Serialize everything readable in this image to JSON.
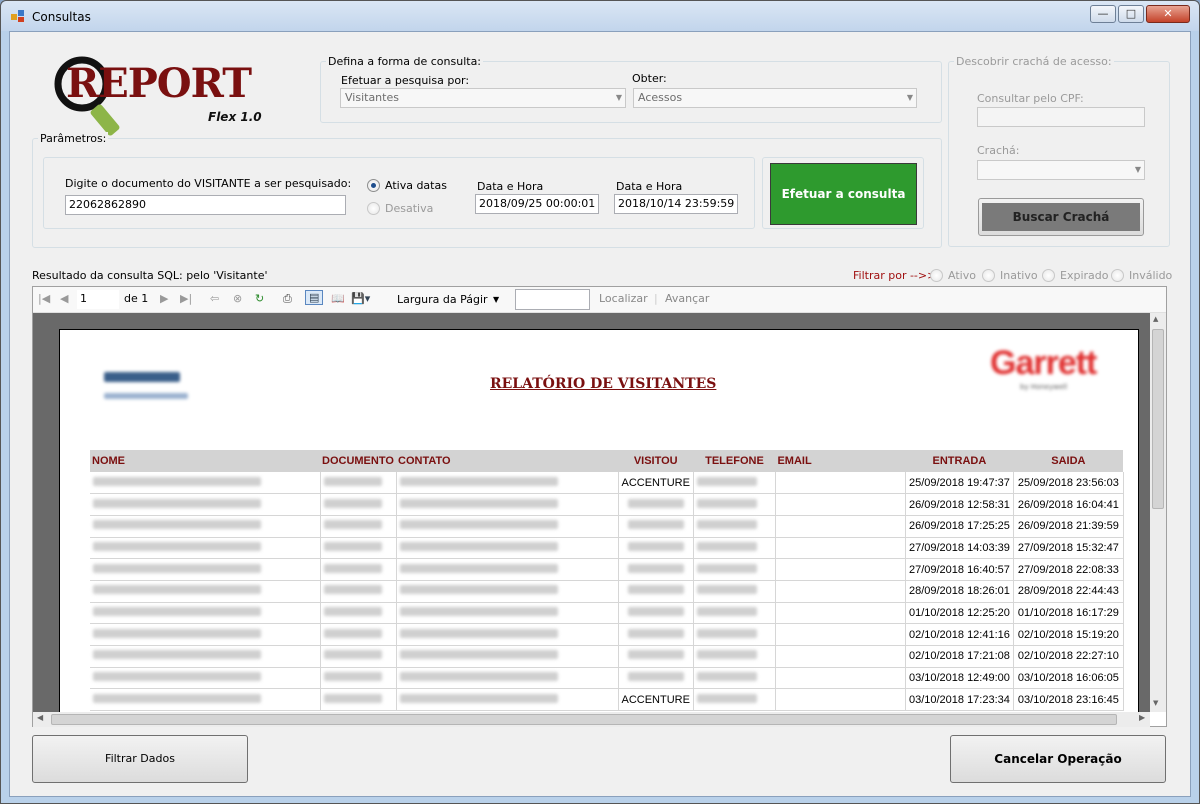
{
  "window": {
    "title": "Consultas",
    "min": "—",
    "max": "□",
    "close": "✕"
  },
  "logo": {
    "word": "REPORT",
    "sub": "Flex 1.0"
  },
  "consulta": {
    "group_label": "Defina a forma de consulta:",
    "pesquisa_label": "Efetuar a pesquisa por:",
    "pesquisa_value": "Visitantes",
    "obter_label": "Obter:",
    "obter_value": "Acessos"
  },
  "cracha": {
    "group_label": "Descobrir crachá de acesso:",
    "cpf_label": "Consultar pelo CPF:",
    "cracha_label": "Crachá:",
    "buscar": "Buscar Crachá"
  },
  "parametros": {
    "group_label": "Parâmetros:",
    "doc_label": "Digite o documento do VISITANTE a ser pesquisado:",
    "doc_value": "22062862890",
    "ativa": "Ativa datas",
    "desativa": "Desativa",
    "data1_label": "Data e Hora",
    "data1_value": "2018/09/25 00:00:01",
    "data2_label": "Data e Hora",
    "data2_value": "2018/10/14 23:59:59",
    "submit": "Efetuar a consulta"
  },
  "resultado": {
    "label": "Resultado da consulta SQL: pelo 'Visitante'",
    "filtrar_por": "Filtrar por  -->>",
    "filters": [
      "Ativo",
      "Inativo",
      "Expirado",
      "Inválido"
    ]
  },
  "toolbar": {
    "page": "1",
    "of": "de 1",
    "zoom": "Largura da Págir",
    "find": "Localizar",
    "next": "Avançar"
  },
  "report": {
    "title": "RELATÓRIO DE VISITANTES",
    "brand": "Garrett",
    "brand_sub": "by Honeywell",
    "columns": [
      "NOME",
      "DOCUMENTO",
      "CONTATO",
      "VISITOU",
      "TELEFONE",
      "EMAIL",
      "ENTRADA",
      "SAIDA"
    ],
    "rows": [
      {
        "visitou": "ACCENTURE",
        "entrada": "25/09/2018 19:47:37",
        "saida": "25/09/2018 23:56:03"
      },
      {
        "visitou": "",
        "entrada": "26/09/2018 12:58:31",
        "saida": "26/09/2018 16:04:41"
      },
      {
        "visitou": "",
        "entrada": "26/09/2018 17:25:25",
        "saida": "26/09/2018 21:39:59"
      },
      {
        "visitou": "",
        "entrada": "27/09/2018 14:03:39",
        "saida": "27/09/2018 15:32:47"
      },
      {
        "visitou": "",
        "entrada": "27/09/2018 16:40:57",
        "saida": "27/09/2018 22:08:33"
      },
      {
        "visitou": "",
        "entrada": "28/09/2018 18:26:01",
        "saida": "28/09/2018 22:44:43"
      },
      {
        "visitou": "",
        "entrada": "01/10/2018 12:25:20",
        "saida": "01/10/2018 16:17:29"
      },
      {
        "visitou": "",
        "entrada": "02/10/2018 12:41:16",
        "saida": "02/10/2018 15:19:20"
      },
      {
        "visitou": "",
        "entrada": "02/10/2018 17:21:08",
        "saida": "02/10/2018 22:27:10"
      },
      {
        "visitou": "",
        "entrada": "03/10/2018 12:49:00",
        "saida": "03/10/2018 16:06:05"
      },
      {
        "visitou": "ACCENTURE",
        "entrada": "03/10/2018 17:23:34",
        "saida": "03/10/2018 23:16:45"
      }
    ]
  },
  "footer": {
    "filtrar": "Filtrar Dados",
    "cancelar": "Cancelar Operação"
  },
  "colors": {
    "submit_bg": "#2e9a2e",
    "buscar_bg": "#7a7a7a",
    "header_text": "#7a0f0f"
  }
}
